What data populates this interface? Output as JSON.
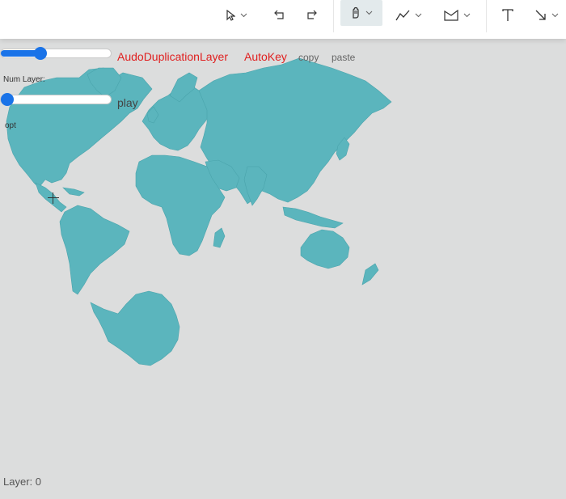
{
  "toolbar": {
    "tools": [
      {
        "name": "select-tool",
        "icon": "cursor-icon",
        "has_dropdown": true
      },
      {
        "name": "undo-tool",
        "icon": "undo-icon",
        "has_dropdown": false
      },
      {
        "name": "redo-tool",
        "icon": "redo-icon",
        "has_dropdown": false
      },
      {
        "name": "pan-tool",
        "icon": "hand-icon",
        "has_dropdown": true,
        "active": true
      },
      {
        "name": "line-tool",
        "icon": "polyline-icon",
        "has_dropdown": true
      },
      {
        "name": "polygon-tool",
        "icon": "polygon-icon",
        "has_dropdown": true
      },
      {
        "name": "text-tool",
        "icon": "text-icon",
        "has_dropdown": false
      },
      {
        "name": "arrow-tool",
        "icon": "arrow-icon",
        "has_dropdown": true
      }
    ]
  },
  "controls": {
    "slider1_value": 0.34,
    "slider2_value": 0.0,
    "auto_duplication_label": "AudoDuplicationLayer",
    "auto_key_label": "AutoKey",
    "copy_label": "copy",
    "paste_label": "paste",
    "num_layer_label": "Num Layer:",
    "play_label": "play",
    "opt_label": "opt"
  },
  "footer": {
    "layer_text": "Layer: 0"
  },
  "colors": {
    "land": "#5bb5bd",
    "background": "#dcdddd",
    "accent": "#1a73e8",
    "label_red": "#e02020"
  }
}
